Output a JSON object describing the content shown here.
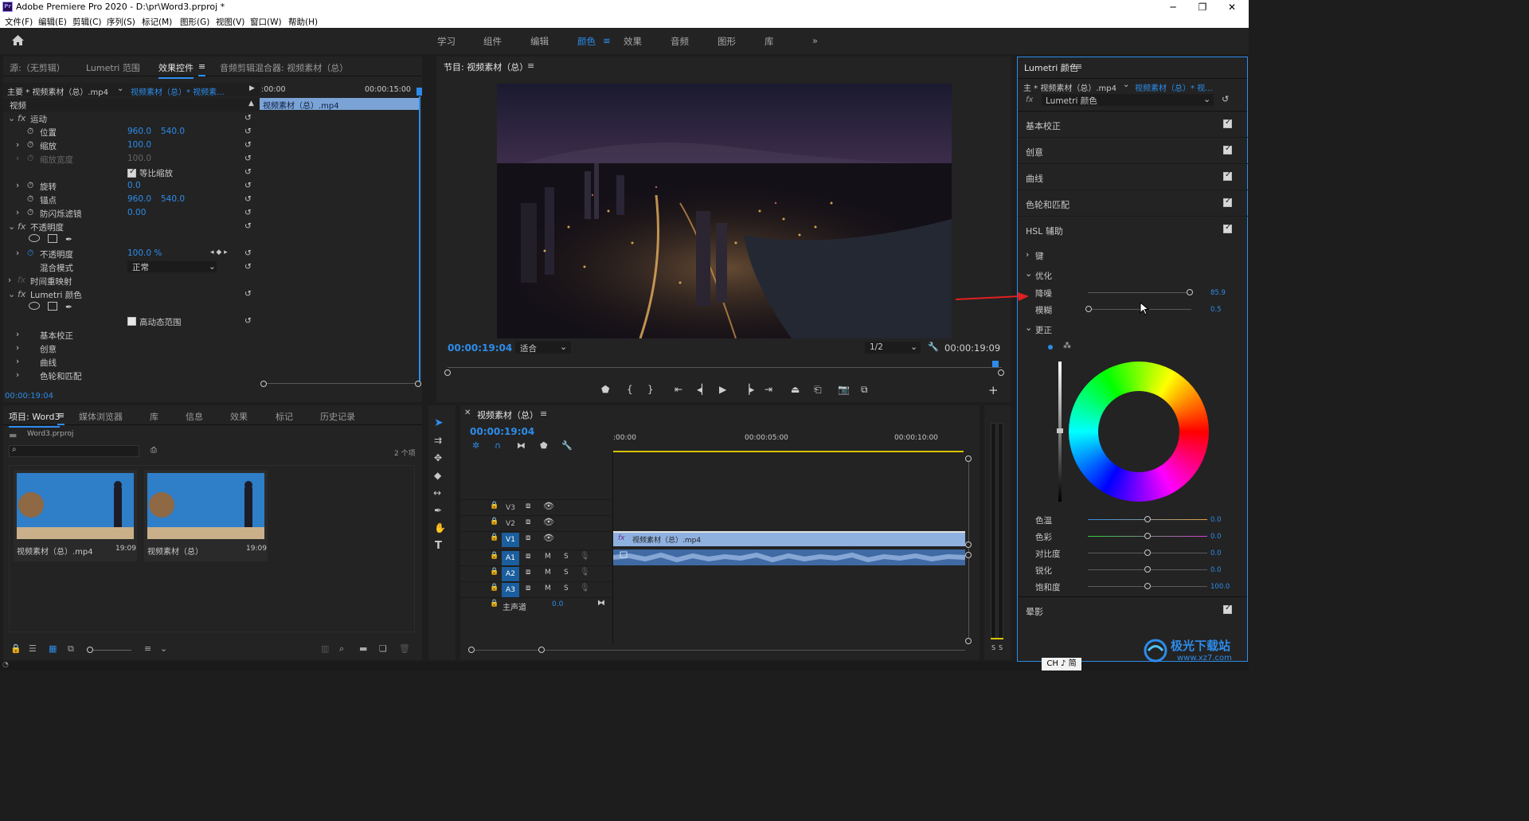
{
  "window": {
    "title": "Adobe Premiere Pro 2020 - D:\\pr\\Word3.prproj *",
    "minimize": "─",
    "maximize": "❐",
    "close": "✕"
  },
  "menu": [
    "文件(F)",
    "编辑(E)",
    "剪辑(C)",
    "序列(S)",
    "标记(M)",
    "图形(G)",
    "视图(V)",
    "窗口(W)",
    "帮助(H)"
  ],
  "workspaces": [
    "学习",
    "组件",
    "编辑",
    "颜色",
    "效果",
    "音频",
    "图形",
    "库"
  ],
  "workspace_active": "颜色",
  "effect_panel": {
    "tabs": [
      "源:（无剪辑）",
      "Lumetri 范围",
      "效果控件",
      "音频剪辑混合器: 视频素材（总）"
    ],
    "master": "主要 * 视频素材（总）.mp4",
    "clip": "视频素材（总）* 视频素...",
    "time_start": ":00:00",
    "time_end": "00:00:15:00",
    "clip_bar": "视频素材（总）.mp4",
    "section_video": "视频",
    "motion": "运动",
    "position": {
      "label": "位置",
      "x": "960.0",
      "y": "540.0"
    },
    "scale": {
      "label": "缩放",
      "value": "100.0"
    },
    "scale_width": {
      "label": "缩放宽度",
      "value": "100.0"
    },
    "uniform_scale": "等比缩放",
    "rotation": {
      "label": "旋转",
      "value": "0.0"
    },
    "anchor": {
      "label": "锚点",
      "x": "960.0",
      "y": "540.0"
    },
    "anti_flicker": {
      "label": "防闪烁滤镜",
      "value": "0.00"
    },
    "opacity_group": "不透明度",
    "opacity": {
      "label": "不透明度",
      "value": "100.0 %"
    },
    "blend_mode": {
      "label": "混合模式",
      "value": "正常"
    },
    "time_remap": "时间重映射",
    "lumetri": "Lumetri 颜色",
    "hdr": "高动态范围",
    "sub_items": [
      "基本校正",
      "创意",
      "曲线",
      "色轮和匹配"
    ],
    "timecode": "00:00:19:04"
  },
  "program": {
    "title": "节目: 视频素材（总）",
    "timecode": "00:00:19:04",
    "fit": "适合",
    "resolution": "1/2",
    "duration": "00:00:19:09"
  },
  "project": {
    "tabs": [
      "项目: Word3",
      "媒体浏览器",
      "库",
      "信息",
      "效果",
      "标记",
      "历史记录"
    ],
    "file": "Word3.prproj",
    "count": "2 个项",
    "items": [
      {
        "name": "视频素材（总）.mp4",
        "duration": "19:09"
      },
      {
        "name": "视频素材（总）",
        "duration": "19:09"
      }
    ]
  },
  "timeline": {
    "title": "视频素材（总）",
    "timecode": "00:00:19:04",
    "ruler": [
      ":00:00",
      "00:00:05:00",
      "00:00:10:00"
    ],
    "video_tracks": [
      "V3",
      "V2",
      "V1"
    ],
    "audio_tracks": [
      "A1",
      "A2",
      "A3"
    ],
    "master": "主声道",
    "master_value": "0.0",
    "clip": "视频素材（总）.mp4",
    "M": "M",
    "S": "S"
  },
  "lumetri": {
    "title": "Lumetri 颜色",
    "master": "主 * 视频素材（总）.mp4",
    "clip": "视频素材（总）* 视...",
    "effect": "Lumetri 颜色",
    "sections": [
      "基本校正",
      "创意",
      "曲线",
      "色轮和匹配",
      "HSL 辅助"
    ],
    "key": "键",
    "refine": "优化",
    "denoise": {
      "label": "降噪",
      "value": "85.9"
    },
    "blur": {
      "label": "模糊",
      "value": "0.5"
    },
    "correction": "更正",
    "temperature": {
      "label": "色温",
      "value": "0.0"
    },
    "tint": {
      "label": "色彩",
      "value": "0.0"
    },
    "contrast": {
      "label": "对比度",
      "value": "0.0"
    },
    "sharpen": {
      "label": "锐化",
      "value": "0.0"
    },
    "saturation": {
      "label": "饱和度",
      "value": "100.0"
    },
    "vignette": "晕影"
  },
  "ime": "CH ♪ 简",
  "watermark": {
    "main": "极光下载站",
    "url": "www.xz7.com"
  },
  "colors": {
    "accent": "#2d8ceb",
    "panel": "#232323",
    "bg": "#1d1d1d"
  }
}
